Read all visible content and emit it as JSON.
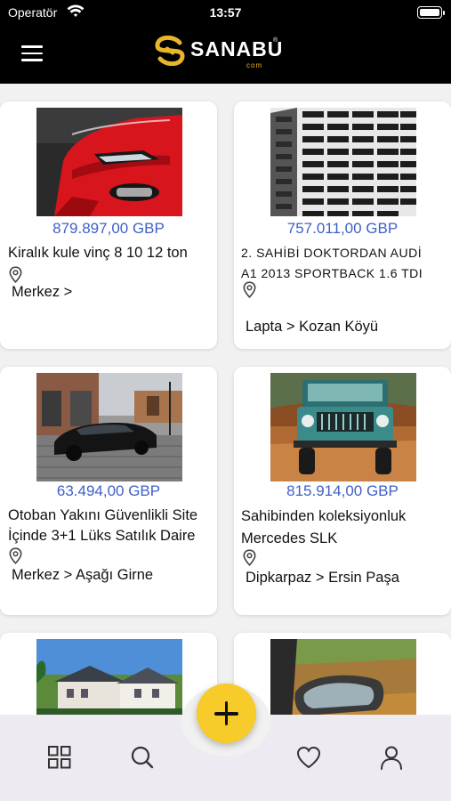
{
  "status_bar": {
    "carrier": "Operatör",
    "time": "13:57"
  },
  "header": {
    "logo_text": "SANABU",
    "logo_sub": "com",
    "logo_reg": "®",
    "menu_icon": "hamburger-menu-icon"
  },
  "listings": [
    {
      "price": "879.897,00  GBP",
      "title_lines": [
        "Kiralık kule vinç 8 10 12 ton"
      ],
      "location": "Merkez >"
    },
    {
      "price": "757.011,00  GBP",
      "title_lines": [
        "2. SAHİBİ DOKTORDAN AUDİ",
        "A1 2013 SPORTBACK 1.6 TDI"
      ],
      "location": "Lapta > Kozan Köyü"
    },
    {
      "price": "63.494,00  GBP",
      "title_lines": [
        "Otoban Yakını Güvenlikli Site",
        "İçinde 3+1 Lüks Satılık Daire"
      ],
      "location": "Merkez > Aşağı Girne"
    },
    {
      "price": "815.914,00  GBP",
      "title_lines": [
        "Sahibinden koleksiyonluk",
        "Mercedes SLK"
      ],
      "location": "Dipkarpaz > Ersin Paşa"
    }
  ],
  "bottom_nav": {
    "items": [
      {
        "icon": "grid-icon"
      },
      {
        "icon": "search-icon"
      },
      {
        "icon": "heart-icon"
      },
      {
        "icon": "user-icon"
      }
    ],
    "fab_icon": "plus-icon"
  },
  "colors": {
    "accent": "#f7cb2a",
    "price": "#3f5fc7",
    "header_bg": "#000000",
    "bottom_bar": "#eeeaf1"
  }
}
